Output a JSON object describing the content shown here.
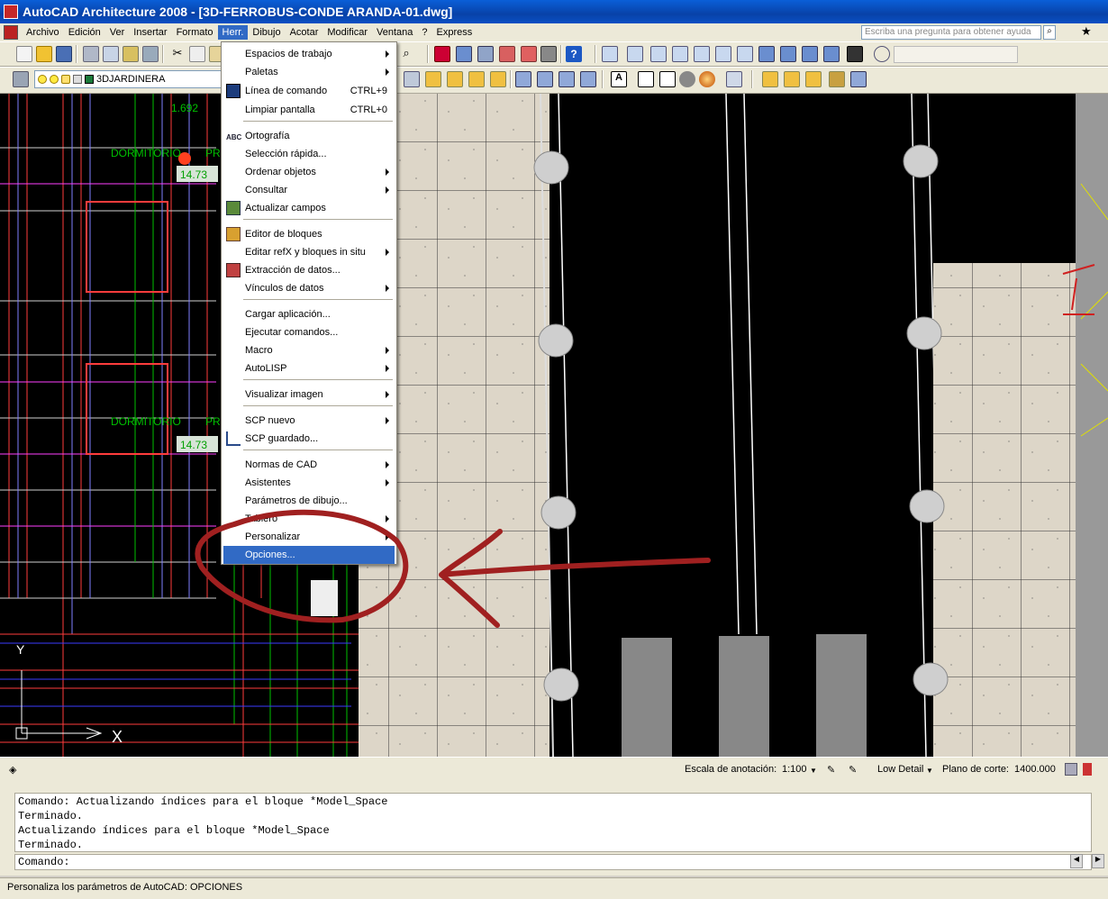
{
  "window": {
    "title": "AutoCAD Architecture 2008 - [3D-FERROBUS-CONDE ARANDA-01.dwg]"
  },
  "menubar": {
    "items": [
      "Archivo",
      "Edición",
      "Ver",
      "Insertar",
      "Formato",
      "Herr.",
      "Dibujo",
      "Acotar",
      "Modificar",
      "Ventana",
      "?",
      "Express"
    ],
    "active": "Herr.",
    "help_placeholder": "Escriba una pregunta para obtener ayuda"
  },
  "toolbar": {
    "layer_name": "3DJARDINERA"
  },
  "tools_menu": {
    "items": [
      {
        "label": "Espacios de trabajo",
        "submenu": true
      },
      {
        "label": "Paletas",
        "submenu": true
      },
      {
        "label": "Línea de comando",
        "shortcut": "CTRL+9"
      },
      {
        "label": "Limpiar pantalla",
        "shortcut": "CTRL+0"
      },
      {
        "label": "Ortografía"
      },
      {
        "label": "Selección rápida..."
      },
      {
        "label": "Ordenar objetos",
        "submenu": true
      },
      {
        "label": "Consultar",
        "submenu": true
      },
      {
        "label": "Actualizar campos"
      },
      {
        "label": "Editor de bloques"
      },
      {
        "label": "Editar refX y bloques in situ",
        "submenu": true
      },
      {
        "label": "Extracción de datos..."
      },
      {
        "label": "Vínculos de datos",
        "submenu": true
      },
      {
        "label": "Cargar aplicación..."
      },
      {
        "label": "Ejecutar comandos..."
      },
      {
        "label": "Macro",
        "submenu": true
      },
      {
        "label": "AutoLISP",
        "submenu": true
      },
      {
        "label": "Visualizar imagen",
        "submenu": true
      },
      {
        "label": "SCP nuevo",
        "submenu": true
      },
      {
        "label": "SCP guardado..."
      },
      {
        "label": "Normas de CAD",
        "submenu": true
      },
      {
        "label": "Asistentes",
        "submenu": true
      },
      {
        "label": "Parámetros de dibujo..."
      },
      {
        "label": "Tablero",
        "submenu": true
      },
      {
        "label": "Personalizar",
        "submenu": true
      },
      {
        "label": "Opciones...",
        "highlighted": true
      }
    ]
  },
  "drawing": {
    "room_label": "DORMITORIO",
    "room_label_suffix": "PR",
    "dim_a": "14.73",
    "dim_b": "14.73",
    "dim_c": "1.692",
    "axis_x": "X",
    "axis_y": "Y"
  },
  "statusbar": {
    "annotation_scale_label": "Escala de anotación:",
    "annotation_scale": "1:100",
    "detail": "Low Detail",
    "cut_plane_label": "Plano de corte:",
    "cut_plane": "1400.000"
  },
  "command": {
    "history": [
      "Comando: Actualizando índices para el bloque *Model_Space",
      "Terminado.",
      "Actualizando índices para el bloque *Model_Space",
      "Terminado."
    ],
    "prompt": "Comando:"
  },
  "footer": {
    "status": "Personaliza los parámetros de AutoCAD: OPCIONES"
  },
  "colors": {
    "titlebar": "#0a5fd8",
    "highlight": "#316ac5",
    "annotation": "#a02020",
    "paving": "#ddd6c8"
  }
}
